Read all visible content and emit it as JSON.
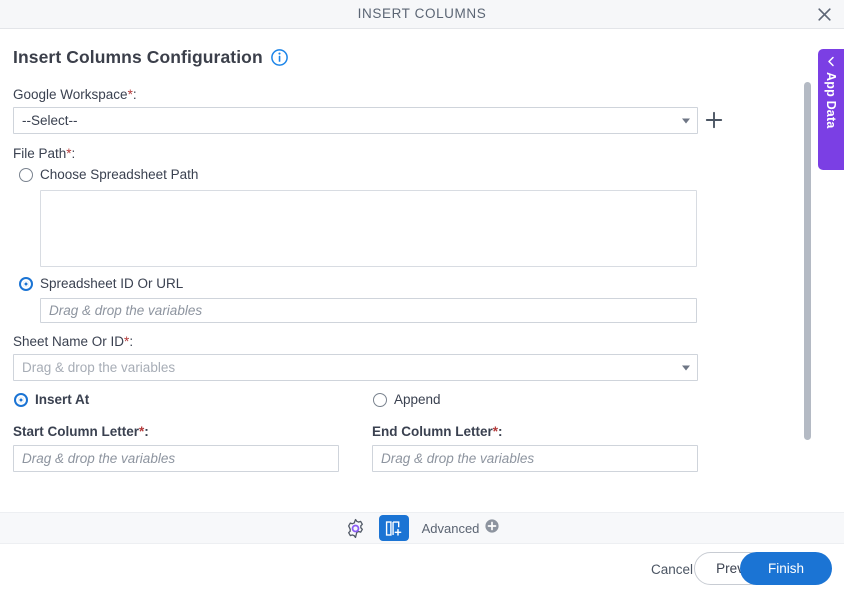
{
  "window": {
    "title": "INSERT COLUMNS",
    "close_icon": "close-icon"
  },
  "page": {
    "heading": "Insert Columns Configuration",
    "info_icon": "info-circle-icon"
  },
  "fields": {
    "google_workspace": {
      "label": "Google Workspace",
      "required_mark": "*",
      "suffix": ":",
      "value": "--Select--",
      "add_icon": "plus-icon"
    },
    "file_path": {
      "label": "File Path",
      "required_mark": "*",
      "suffix": ":"
    },
    "choose_spreadsheet_path": {
      "label": "Choose Spreadsheet Path",
      "selected": false
    },
    "spreadsheet_id_or_url": {
      "label": "Spreadsheet ID Or URL",
      "selected": true,
      "placeholder": "Drag & drop the variables"
    },
    "sheet_name_or_id": {
      "label": "Sheet Name Or ID",
      "required_mark": "*",
      "suffix": ":",
      "placeholder": "Drag & drop the variables"
    },
    "insert_at": {
      "label": "Insert At",
      "selected": true
    },
    "append": {
      "label": "Append",
      "selected": false
    },
    "start_column_letter": {
      "label": "Start Column Letter",
      "required_mark": "*",
      "suffix": ":",
      "placeholder": "Drag & drop the variables"
    },
    "end_column_letter": {
      "label": "End Column Letter",
      "required_mark": "*",
      "suffix": ":",
      "placeholder": "Drag & drop the variables"
    }
  },
  "side_panel": {
    "label": "App Data",
    "collapse_icon": "chevron-left-icon"
  },
  "toolbar": {
    "settings_icon": "gear-icon",
    "insert_columns_icon": "insert-columns-icon",
    "advanced_label": "Advanced",
    "advanced_icon": "plus-circle-icon"
  },
  "footer": {
    "cancel_label": "Cancel",
    "prev_label": "Prev",
    "finish_label": "Finish"
  },
  "colors": {
    "accent": "#1b74d4",
    "purple": "#7b3fe4",
    "required": "#b33a3a",
    "toolbar_bg": "#f7f8fa",
    "titlebar_bg": "#f6f7f9"
  }
}
